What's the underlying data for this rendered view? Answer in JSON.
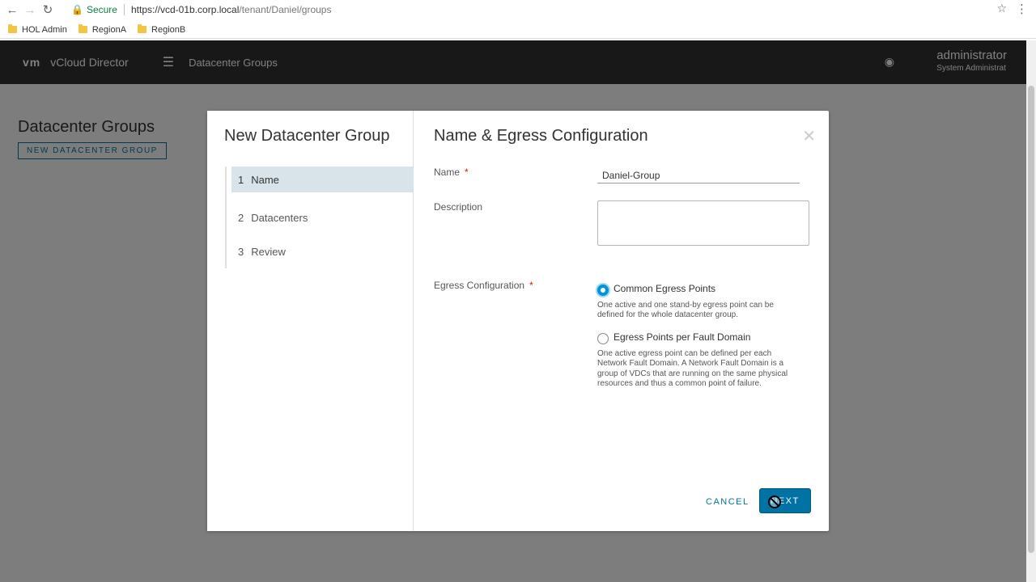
{
  "browser": {
    "secure_label": "Secure",
    "url_host": "https://vcd-01b.corp.local",
    "url_path": "/tenant/Daniel/groups",
    "bookmarks": [
      "HOL Admin",
      "RegionA",
      "RegionB"
    ]
  },
  "app": {
    "logo": "vm",
    "title": "vCloud Director",
    "section": "Datacenter Groups",
    "user_name": "administrator",
    "user_org": "System  Administrat",
    "page_title": "Datacenter Groups",
    "page_button": "NEW DATACENTER GROUP"
  },
  "wizard": {
    "title": "New Datacenter Group",
    "steps": [
      {
        "num": "1",
        "label": "Name"
      },
      {
        "num": "2",
        "label": "Datacenters"
      },
      {
        "num": "3",
        "label": "Review"
      }
    ],
    "page_title": "Name & Egress Configuration",
    "name_label": "Name",
    "name_value": "Daniel-Group",
    "description_label": "Description",
    "egress_label": "Egress Configuration",
    "required_mark": "*",
    "option1_label": "Common Egress Points",
    "option1_help": "One active and one stand-by egress point can be defined for the whole datacenter group.",
    "option2_label": "Egress Points per Fault Domain",
    "option2_help": "One active egress point can be defined per each Network Fault Domain. A Network Fault Domain is a group of VDCs that are running on the same physical resources and thus a common point of failure.",
    "cancel_label": "CANCEL",
    "next_label": "NEXT"
  },
  "colors": {
    "accent": "#0072a3",
    "radio_selected": "#0095d3",
    "active_step": "#d9e4ea"
  }
}
